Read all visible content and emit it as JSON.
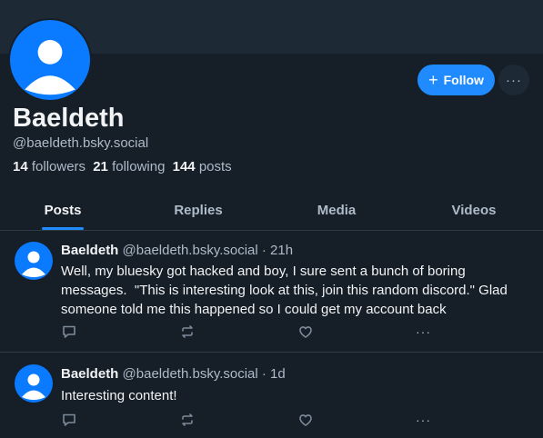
{
  "profile": {
    "display_name": "Baeldeth",
    "handle": "@baeldeth.bsky.social",
    "followers_count": "14",
    "followers_label": "followers",
    "following_count": "21",
    "following_label": "following",
    "posts_count": "144",
    "posts_label": "posts"
  },
  "actions": {
    "follow_label": "Follow",
    "more_label": "···"
  },
  "tabs": [
    {
      "label": "Posts",
      "active": true
    },
    {
      "label": "Replies",
      "active": false
    },
    {
      "label": "Media",
      "active": false
    },
    {
      "label": "Videos",
      "active": false
    }
  ],
  "posts": [
    {
      "author": "Baeldeth",
      "meta": "@baeldeth.bsky.social · 21h",
      "text": "Well, my bluesky got hacked and boy, I sure sent a bunch of boring messages.  \"This is interesting look at this, join this random discord.\" Glad someone told me this happened so I could get my account back",
      "more_label": "···"
    },
    {
      "author": "Baeldeth",
      "meta": "@baeldeth.bsky.social · 1d",
      "text": "Interesting content!",
      "more_label": "···"
    }
  ],
  "colors": {
    "background": "#161e27",
    "accent": "#208bfe",
    "avatar": "#0a7aff",
    "muted_text": "#aebbc9"
  }
}
